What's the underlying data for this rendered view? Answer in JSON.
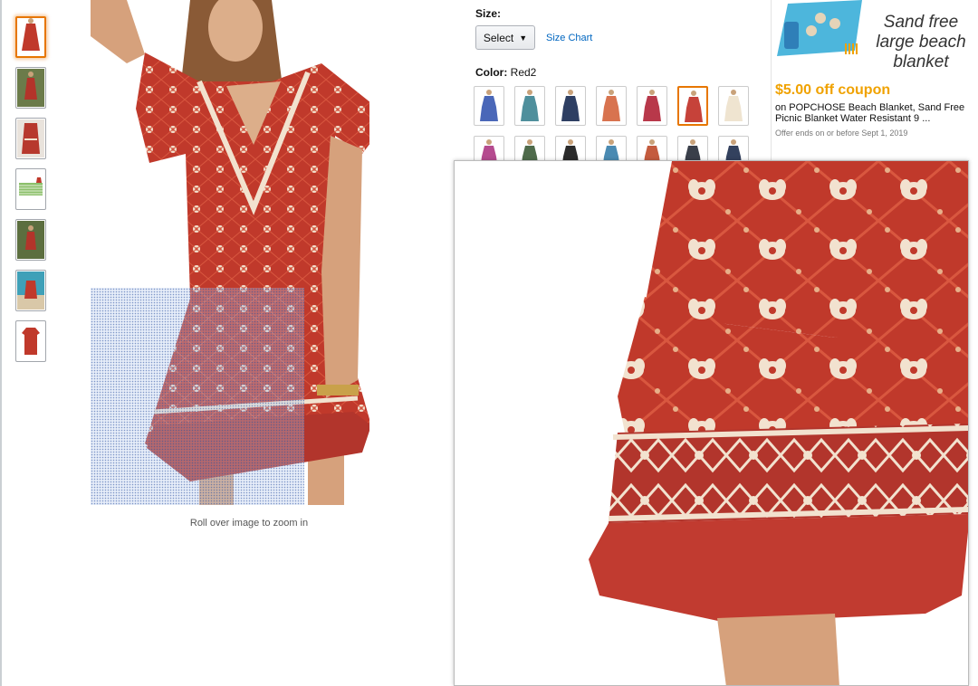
{
  "size": {
    "label": "Size:",
    "select_value": "Select",
    "size_chart_link": "Size Chart"
  },
  "color": {
    "label": "Color:",
    "selected_value": "Red2",
    "swatch_colors": [
      "#4a67b8",
      "#4f8f9c",
      "#2e3f63",
      "#d8734f",
      "#b8384a",
      "#c6423a",
      "#efe4d0",
      "#b54b8f",
      "#4f6b4b",
      "#2b2b2b",
      "#4a8ab2",
      "#c45b3e",
      "#3a3f4a",
      "#33415e"
    ],
    "selected_index": 5
  },
  "gallery": {
    "rollover_text": "Roll over image to zoom in",
    "thumbnails": [
      {
        "name": "red-dress-front",
        "selected": true
      },
      {
        "name": "red-dress-outdoor"
      },
      {
        "name": "red-dress-detail"
      },
      {
        "name": "size-chart-thumb"
      },
      {
        "name": "red-dress-garden"
      },
      {
        "name": "red-dress-beach"
      },
      {
        "name": "red-dress-flat"
      }
    ]
  },
  "ad": {
    "headline_1": "Sand free",
    "headline_2": "large beach",
    "headline_3": "blanket",
    "coupon": "$5.00 off coupon",
    "description": "on POPCHOSE Beach Blanket, Sand Free Picnic Blanket Water Resistant 9 ...",
    "fine_print": "Offer ends on or before Sept 1, 2019"
  },
  "colors": {
    "dress_red": "#c0392b",
    "dress_dark": "#8e2a23",
    "pattern_cream": "#f2e2cf",
    "selected_border": "#e77600",
    "link_blue": "#0066c0",
    "coupon_orange": "#f0a200"
  }
}
